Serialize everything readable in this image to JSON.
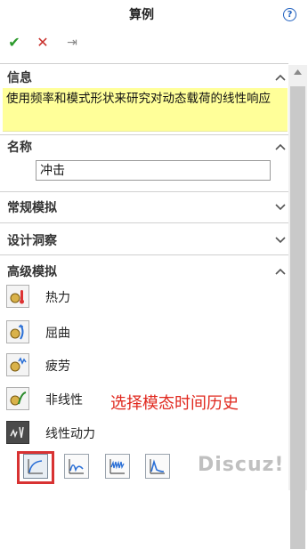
{
  "window": {
    "title": "算例",
    "help_label": "?"
  },
  "toolbar": {
    "ok_glyph": "✔",
    "cancel_glyph": "✕",
    "pin_glyph": "⇥"
  },
  "sections": {
    "info": {
      "title": "信息",
      "text": "使用频率和模式形状来研究对动态载荷的线性响应",
      "expanded": true
    },
    "name": {
      "title": "名称",
      "value": "冲击",
      "expanded": true
    },
    "general": {
      "title": "常规模拟",
      "expanded": false
    },
    "design": {
      "title": "设计洞察",
      "expanded": false
    },
    "advanced": {
      "title": "高级模拟",
      "expanded": true,
      "items": [
        {
          "label": "热力",
          "icon": "thermal-icon"
        },
        {
          "label": "屈曲",
          "icon": "buckling-icon"
        },
        {
          "label": "疲劳",
          "icon": "fatigue-icon"
        },
        {
          "label": "非线性",
          "icon": "nonlinear-icon"
        },
        {
          "label": "线性动力",
          "icon": "linear-dynamic-icon",
          "selected": true
        }
      ],
      "subtypes": [
        {
          "icon": "modal-time-history-icon",
          "selected": true
        },
        {
          "icon": "harmonic-icon",
          "selected": false
        },
        {
          "icon": "random-vibration-icon",
          "selected": false
        },
        {
          "icon": "response-spectrum-icon",
          "selected": false
        }
      ]
    }
  },
  "annotation": {
    "text": "选择模态时间历史",
    "color": "#e0281e"
  },
  "watermark": {
    "text": "Discuz!"
  },
  "colors": {
    "info_bg": "#ffff99",
    "ok": "#2c9a2c",
    "cancel": "#c9302c",
    "help": "#1e5fbf",
    "highlight": "#d83232"
  }
}
